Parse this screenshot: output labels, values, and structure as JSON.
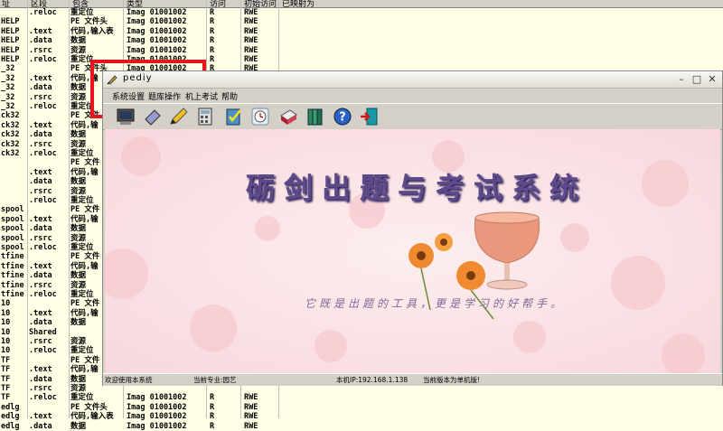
{
  "background_table": {
    "headers": [
      "址",
      "区段",
      "包含",
      "类型",
      "访问",
      "初始访问",
      "已映射为"
    ],
    "rows": [
      {
        "mod": "",
        "sec": ".reloc",
        "contains": "重定位",
        "type": "Imag 01001002",
        "acc": "R",
        "init": "RWE"
      },
      {
        "mod": "HELP",
        "sec": "",
        "contains": "PE 文件头",
        "type": "Imag 01001002",
        "acc": "R",
        "init": "RWE"
      },
      {
        "mod": "HELP",
        "sec": ".text",
        "contains": "代码,输入表",
        "type": "Imag 01001002",
        "acc": "R",
        "init": "RWE"
      },
      {
        "mod": "HELP",
        "sec": ".data",
        "contains": "数据",
        "type": "Imag 01001002",
        "acc": "R",
        "init": "RWE"
      },
      {
        "mod": "HELP",
        "sec": ".rsrc",
        "contains": "资源",
        "type": "Imag 01001002",
        "acc": "R",
        "init": "RWE"
      },
      {
        "mod": "HELP",
        "sec": ".reloc",
        "contains": "重定位",
        "type": "Imag 01001002",
        "acc": "R",
        "init": "RWE"
      },
      {
        "mod": "_32",
        "sec": "",
        "contains": "PE 文件头",
        "type": "Imag 01001002",
        "acc": "R",
        "init": "RWE"
      },
      {
        "mod": "_32",
        "sec": ".text",
        "contains": "代码,输",
        "type": "",
        "acc": "",
        "init": ""
      },
      {
        "mod": "_32",
        "sec": ".data",
        "contains": "数据",
        "type": "",
        "acc": "",
        "init": ""
      },
      {
        "mod": "_32",
        "sec": ".rsrc",
        "contains": "资源",
        "type": "",
        "acc": "",
        "init": ""
      },
      {
        "mod": "_32",
        "sec": ".reloc",
        "contains": "重定位",
        "type": "",
        "acc": "",
        "init": ""
      },
      {
        "mod": "ck32",
        "sec": "",
        "contains": "PE 文件",
        "type": "",
        "acc": "",
        "init": ""
      },
      {
        "mod": "ck32",
        "sec": ".text",
        "contains": "代码,输",
        "type": "",
        "acc": "",
        "init": ""
      },
      {
        "mod": "ck32",
        "sec": ".data",
        "contains": "数据",
        "type": "",
        "acc": "",
        "init": ""
      },
      {
        "mod": "ck32",
        "sec": ".rsrc",
        "contains": "资源",
        "type": "",
        "acc": "",
        "init": ""
      },
      {
        "mod": "ck32",
        "sec": ".reloc",
        "contains": "重定位",
        "type": "",
        "acc": "",
        "init": ""
      },
      {
        "mod": "",
        "sec": "",
        "contains": "PE 文件",
        "type": "",
        "acc": "",
        "init": ""
      },
      {
        "mod": "",
        "sec": ".text",
        "contains": "代码,输",
        "type": "",
        "acc": "",
        "init": ""
      },
      {
        "mod": "",
        "sec": ".data",
        "contains": "数据",
        "type": "",
        "acc": "",
        "init": ""
      },
      {
        "mod": "",
        "sec": ".rsrc",
        "contains": "资源",
        "type": "",
        "acc": "",
        "init": ""
      },
      {
        "mod": "",
        "sec": ".reloc",
        "contains": "重定位",
        "type": "",
        "acc": "",
        "init": ""
      },
      {
        "mod": "spool",
        "sec": "",
        "contains": "PE 文件",
        "type": "",
        "acc": "",
        "init": ""
      },
      {
        "mod": "spool",
        "sec": ".text",
        "contains": "代码,输",
        "type": "",
        "acc": "",
        "init": ""
      },
      {
        "mod": "spool",
        "sec": ".data",
        "contains": "数据",
        "type": "",
        "acc": "",
        "init": ""
      },
      {
        "mod": "spool",
        "sec": ".rsrc",
        "contains": "资源",
        "type": "",
        "acc": "",
        "init": ""
      },
      {
        "mod": "spool",
        "sec": ".reloc",
        "contains": "重定位",
        "type": "",
        "acc": "",
        "init": ""
      },
      {
        "mod": "tfine",
        "sec": "",
        "contains": "PE 文件",
        "type": "",
        "acc": "",
        "init": ""
      },
      {
        "mod": "tfine",
        "sec": ".text",
        "contains": "代码,输",
        "type": "",
        "acc": "",
        "init": ""
      },
      {
        "mod": "tfine",
        "sec": ".data",
        "contains": "数据",
        "type": "",
        "acc": "",
        "init": ""
      },
      {
        "mod": "tfine",
        "sec": ".rsrc",
        "contains": "资源",
        "type": "",
        "acc": "",
        "init": ""
      },
      {
        "mod": "tfine",
        "sec": ".reloc",
        "contains": "重定位",
        "type": "",
        "acc": "",
        "init": ""
      },
      {
        "mod": "10",
        "sec": "",
        "contains": "PE 文件",
        "type": "",
        "acc": "",
        "init": ""
      },
      {
        "mod": "10",
        "sec": ".text",
        "contains": "代码,输",
        "type": "",
        "acc": "",
        "init": ""
      },
      {
        "mod": "10",
        "sec": ".data",
        "contains": "数据",
        "type": "",
        "acc": "",
        "init": ""
      },
      {
        "mod": "10",
        "sec": "Shared",
        "contains": "",
        "type": "",
        "acc": "",
        "init": ""
      },
      {
        "mod": "10",
        "sec": ".rsrc",
        "contains": "资源",
        "type": "",
        "acc": "",
        "init": ""
      },
      {
        "mod": "10",
        "sec": ".reloc",
        "contains": "重定位",
        "type": "",
        "acc": "",
        "init": ""
      },
      {
        "mod": "TF",
        "sec": "",
        "contains": "PE 文件",
        "type": "",
        "acc": "",
        "init": ""
      },
      {
        "mod": "TF",
        "sec": ".text",
        "contains": "代码,输",
        "type": "",
        "acc": "",
        "init": ""
      },
      {
        "mod": "TF",
        "sec": ".data",
        "contains": "数据",
        "type": "",
        "acc": "",
        "init": ""
      },
      {
        "mod": "TF",
        "sec": ".rsrc",
        "contains": "资源",
        "type": "",
        "acc": "",
        "init": ""
      },
      {
        "mod": "TF",
        "sec": ".reloc",
        "contains": "重定位",
        "type": "Imag 01001002",
        "acc": "R",
        "init": "RWE"
      },
      {
        "mod": "edlg",
        "sec": "",
        "contains": "PE 文件头",
        "type": "Imag 01001002",
        "acc": "R",
        "init": "RWE"
      },
      {
        "mod": "edlg",
        "sec": ".text",
        "contains": "代码,输入表",
        "type": "Imag 01001002",
        "acc": "R",
        "init": "RWE"
      },
      {
        "mod": "edlg",
        "sec": ".data",
        "contains": "数据",
        "type": "Imag 01001002",
        "acc": "R",
        "init": "RWE"
      }
    ]
  },
  "window": {
    "title": "pediy",
    "minimize_glyph": "–",
    "maximize_glyph": "□",
    "close_glyph": "✕",
    "menu": [
      "系统设置",
      "题库操作",
      "机上考试",
      "帮助"
    ],
    "toolbar_icons": [
      "monitor-icon",
      "eraser-icon",
      "pencil-icon",
      "calculator-icon",
      "checklist-icon",
      "clock-icon",
      "printer-icon",
      "books-icon",
      "help-icon",
      "exit-door-icon"
    ],
    "banner": "砺剑出题与考试系统",
    "slogan": "它既是出题的工具，更是学习的好帮手。",
    "status": {
      "welcome": "欢迎使用本系统",
      "major": "当前专业:园艺",
      "ip": "本机IP:192.168.1.138",
      "edition": "当前版本为单机版!"
    }
  },
  "colors": {
    "highlight_box": "#e8141c",
    "banner": "#5c4a8a",
    "content_bg": "#fbe3e3"
  }
}
